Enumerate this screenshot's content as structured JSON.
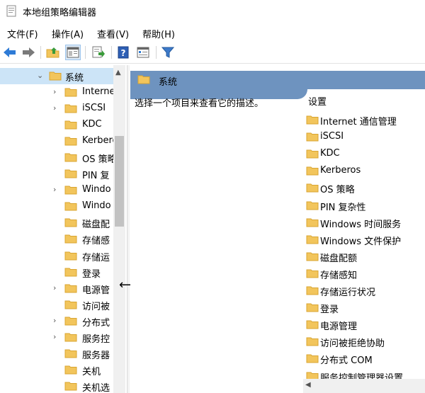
{
  "window": {
    "title": "本地组策略编辑器"
  },
  "menu": [
    "文件(F)",
    "操作(A)",
    "查看(V)",
    "帮助(H)"
  ],
  "toolbar": {
    "buttons": [
      "back-icon",
      "forward-icon",
      "up-folder-icon",
      "show-hide-tree-icon",
      "export-list-icon",
      "help-icon",
      "properties-icon",
      "filter-icon"
    ]
  },
  "colors": {
    "folder": "#f2c55c",
    "folder_edge": "#d9a531",
    "header": "#6e93bf",
    "selected": "#cce4f7",
    "nav_arrow": "#2e7bd6"
  },
  "tree": {
    "root": {
      "label": "系统",
      "expanded": true
    },
    "items": [
      {
        "label": "Interne",
        "expandable": true
      },
      {
        "label": "iSCSI",
        "expandable": true
      },
      {
        "label": "KDC",
        "expandable": false
      },
      {
        "label": "Kerbero",
        "expandable": false
      },
      {
        "label": "OS 策略",
        "expandable": false
      },
      {
        "label": "PIN 复",
        "expandable": false
      },
      {
        "label": "Windo",
        "expandable": true
      },
      {
        "label": "Windo",
        "expandable": false
      },
      {
        "label": "磁盘配",
        "expandable": false
      },
      {
        "label": "存储感",
        "expandable": false
      },
      {
        "label": "存储运",
        "expandable": false
      },
      {
        "label": "登录",
        "expandable": false
      },
      {
        "label": "电源管",
        "expandable": true
      },
      {
        "label": "访问被",
        "expandable": false
      },
      {
        "label": "分布式",
        "expandable": true
      },
      {
        "label": "服务控",
        "expandable": true
      },
      {
        "label": "服务器",
        "expandable": false
      },
      {
        "label": "关机",
        "expandable": false
      },
      {
        "label": "关机选",
        "expandable": false
      }
    ]
  },
  "detail": {
    "header": "系统",
    "description": "选择一个项目来查看它的描述。",
    "column_header": "设置",
    "settings": [
      "Internet 通信管理",
      "iSCSI",
      "KDC",
      "Kerberos",
      "OS 策略",
      "PIN 复杂性",
      "Windows 时间服务",
      "Windows 文件保护",
      "磁盘配额",
      "存储感知",
      "存储运行状况",
      "登录",
      "电源管理",
      "访问被拒绝协助",
      "分布式 COM",
      "服务控制管理器设置"
    ]
  }
}
